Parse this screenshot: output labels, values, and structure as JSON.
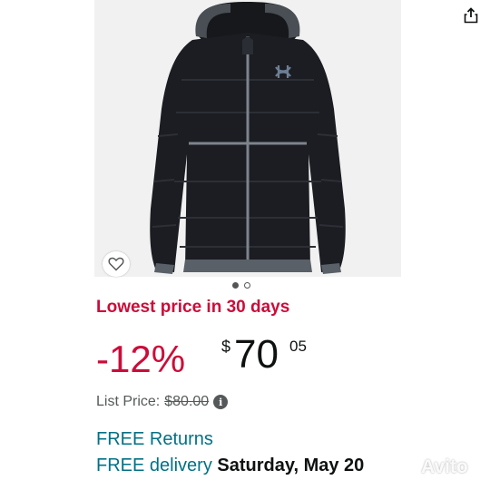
{
  "product_gallery": {
    "brand_logo_icon": "under-armour-logo",
    "share_icon": "share-icon",
    "wishlist_icon": "heart-outline-icon",
    "image_count": 2,
    "active_image": 1
  },
  "deal": {
    "badge": "Lowest price in 30 days",
    "discount": "-12%",
    "currency_symbol": "$",
    "price_whole": "70",
    "price_fraction": "05"
  },
  "list_price": {
    "label": "List Price:",
    "value": "$80.00",
    "icon": "info-icon"
  },
  "shipping": {
    "returns": "FREE Returns",
    "delivery_prefix": "FREE delivery",
    "delivery_date": "Saturday, May 20"
  },
  "watermark": {
    "text": "Avito"
  },
  "colors": {
    "deal_red": "#cc0c39",
    "link_teal": "#007185",
    "text": "#0f1111",
    "muted": "#565959"
  }
}
